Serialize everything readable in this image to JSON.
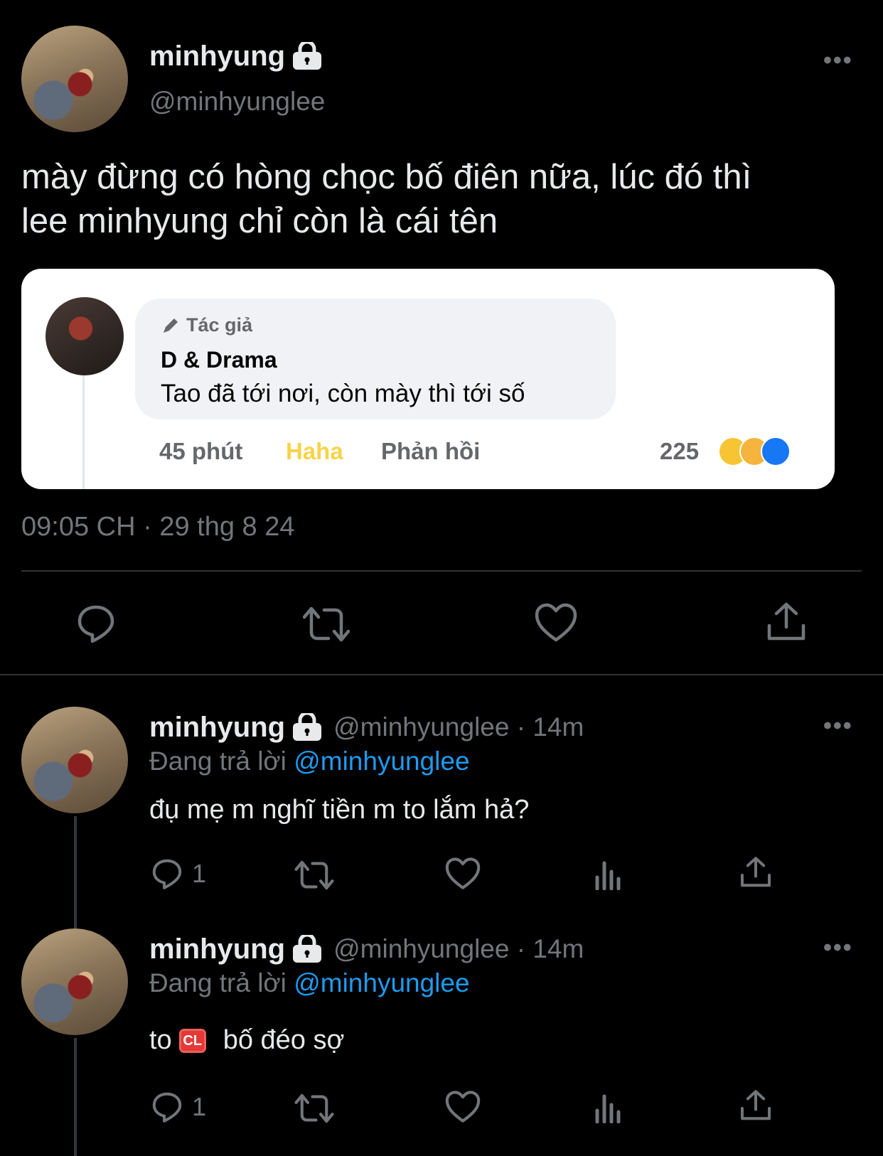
{
  "main_tweet": {
    "name": "minhyung",
    "handle": "@minhyunglee",
    "more": "•••",
    "text_line1": "mày đừng có hòng chọc bố điên nữa, lúc đó thì",
    "text_line2": "lee minhyung chỉ còn là cái tên",
    "timestamp": "09:05 CH · 29 thg 8 24",
    "embedded": {
      "author_badge": "Tác giả",
      "commenter": "D & Drama",
      "comment": "Tao đã tới nơi, còn mày thì tới số",
      "time": "45 phút",
      "haha": "Haha",
      "reply": "Phản hồi",
      "reaction_count": "225"
    }
  },
  "replies": [
    {
      "name": "minhyung",
      "handle_time": "@minhyunglee · 14m",
      "replying_label": "Đang trả lời",
      "replying_to": "@minhyunglee",
      "text": "đụ mẹ m nghĩ tiền m to lắm hả?",
      "reply_count": "1",
      "more": "•••"
    },
    {
      "name": "minhyung",
      "handle_time": "@minhyunglee · 14m",
      "replying_label": "Đang trả lời",
      "replying_to": "@minhyunglee",
      "text_before": "to",
      "badge": "CL",
      "text_after": "bố đéo sợ",
      "reply_count": "1",
      "more": "•••"
    }
  ],
  "icons": {
    "lock": "lock-icon",
    "reply": "reply-icon",
    "retweet": "retweet-icon",
    "like": "heart-icon",
    "share": "share-icon",
    "views": "views-icon"
  },
  "colors": {
    "link": "#1d9bf0",
    "muted": "#71767b",
    "divider": "#2f3336"
  }
}
